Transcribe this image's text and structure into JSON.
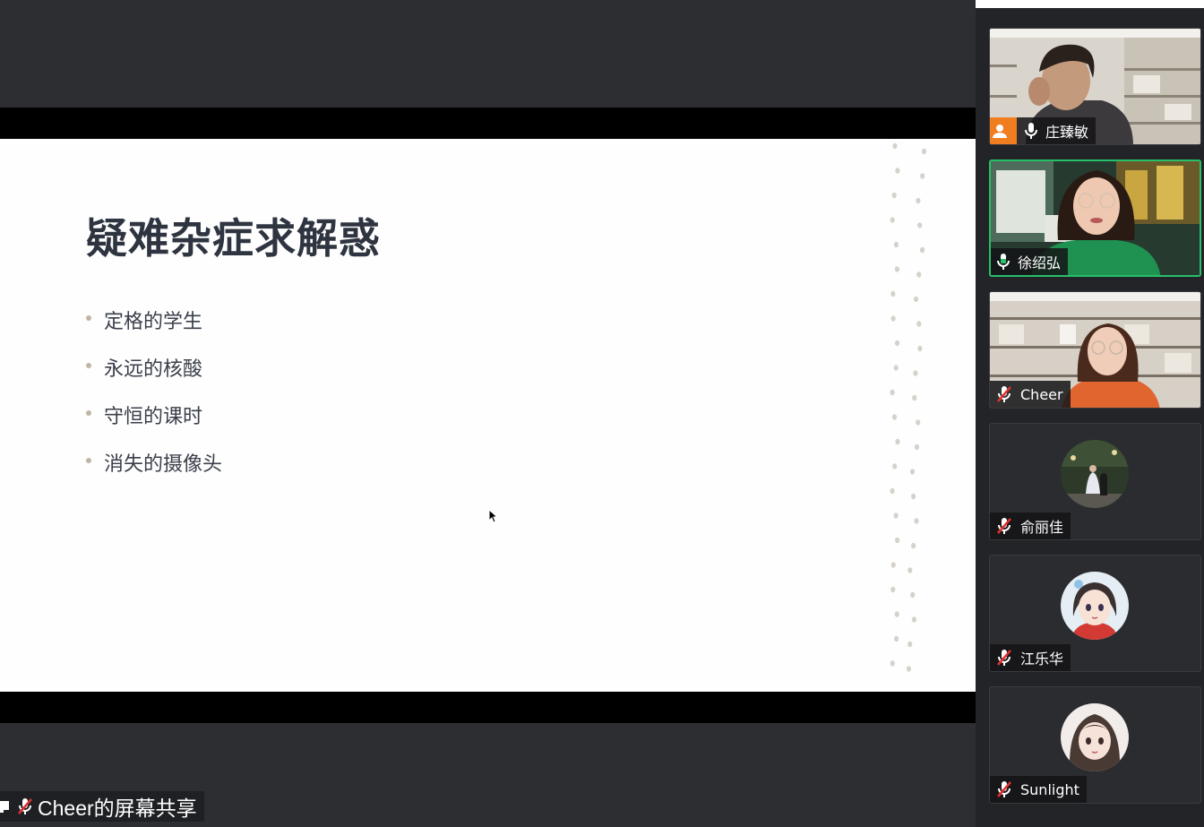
{
  "slide": {
    "title": "疑难杂症求解惑",
    "bullets": [
      "定格的学生",
      "永远的核酸",
      "守恒的课时",
      "消失的摄像头"
    ]
  },
  "share": {
    "label": "Cheer的屏幕共享"
  },
  "participants": [
    {
      "name": "庄臻敏",
      "video": true,
      "mic": "on",
      "host_badge": true
    },
    {
      "name": "徐绍弘",
      "video": true,
      "mic": "speaking",
      "active": true
    },
    {
      "name": "Cheer",
      "video": true,
      "mic": "muted"
    },
    {
      "name": "俞丽佳",
      "video": false,
      "mic": "muted",
      "avatar": "photo"
    },
    {
      "name": "江乐华",
      "video": false,
      "mic": "muted",
      "avatar": "cartoon-girl"
    },
    {
      "name": "Sunlight",
      "video": false,
      "mic": "muted",
      "avatar": "cartoon-girl-dark"
    }
  ],
  "colors": {
    "active_border": "#27c06a",
    "host_badge": "#f07d1f",
    "muted_red": "#e0302f"
  }
}
